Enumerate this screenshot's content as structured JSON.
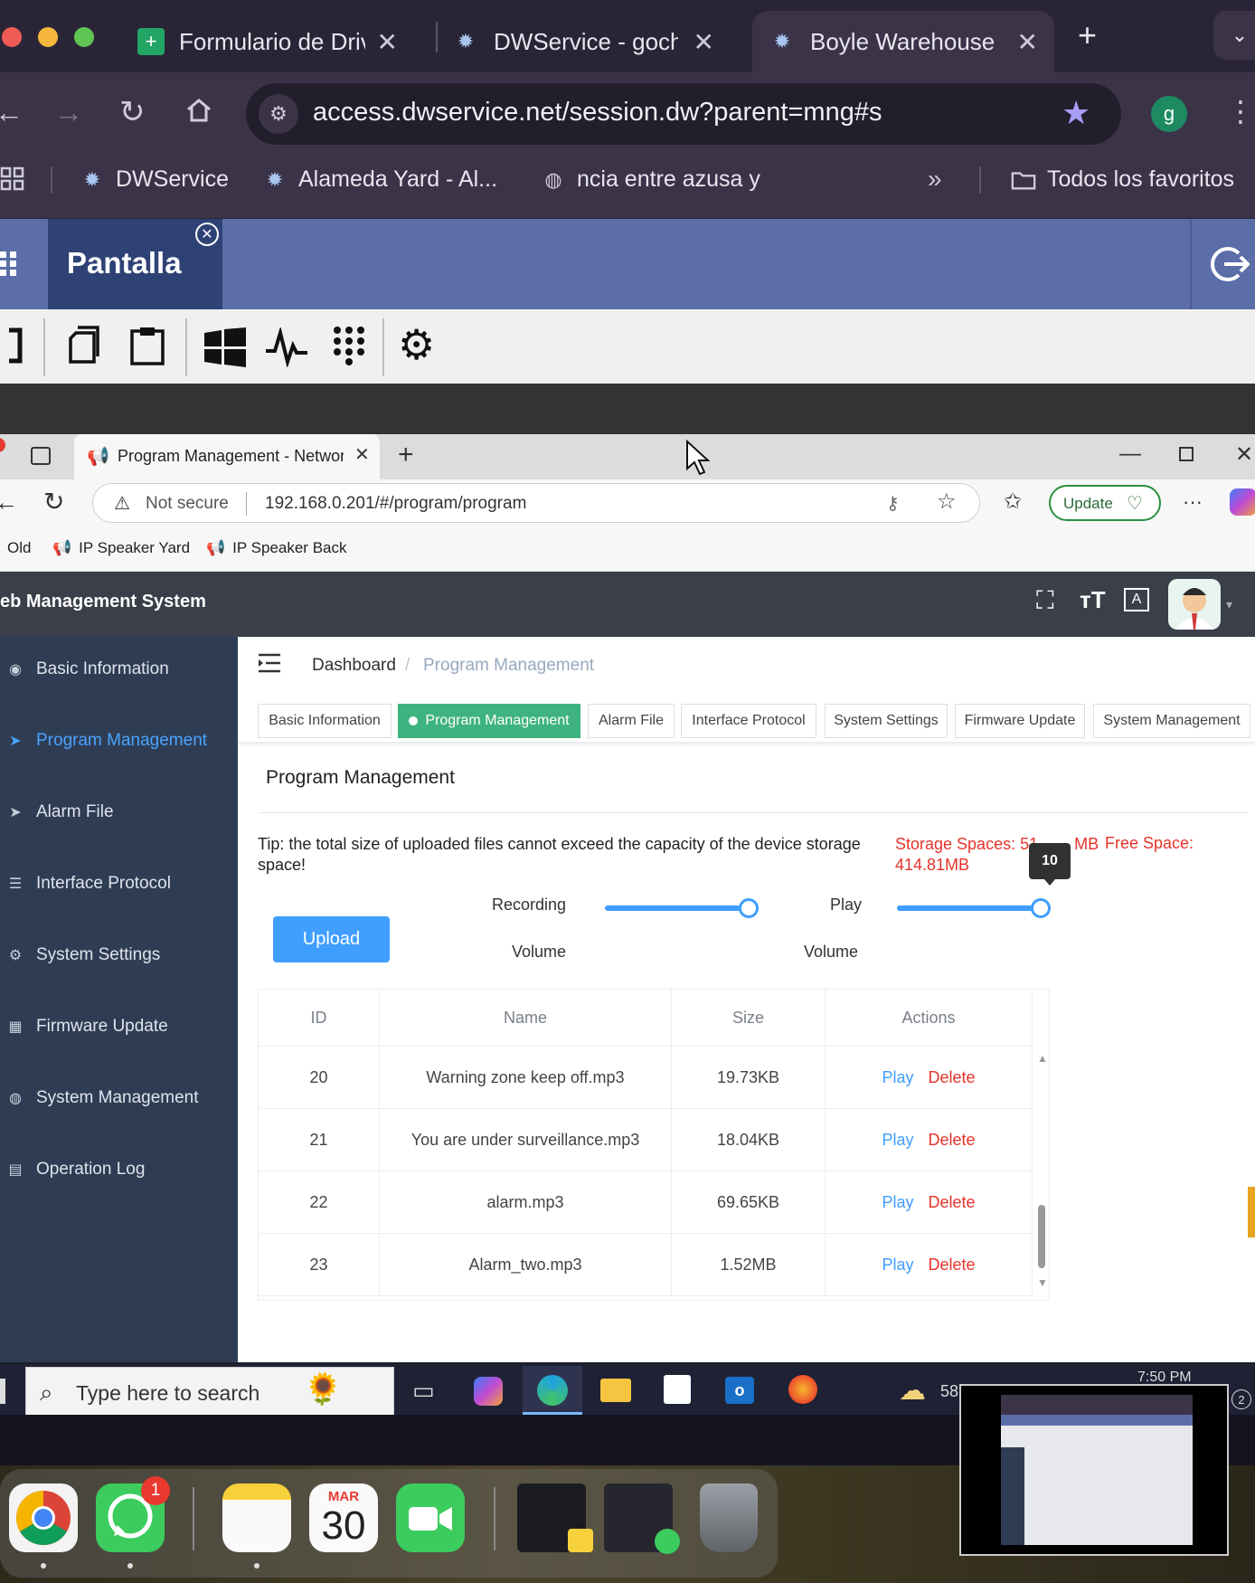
{
  "outer_browser": {
    "tabs": [
      {
        "title": "Formulario de Driv",
        "active": false
      },
      {
        "title": "DWService - goch",
        "active": false
      },
      {
        "title": "Boyle Warehouse",
        "active": true
      }
    ],
    "url": "access.dwservice.net/session.dw?parent=mng#s",
    "profile_initial": "g",
    "bookmarks": [
      {
        "label": "DWService"
      },
      {
        "label": "Alameda Yard - Al..."
      },
      {
        "label": "ncia entre azusa y"
      }
    ],
    "bookmarks_folder": "Todos los favoritos"
  },
  "dwservice": {
    "tab_title": "Pantalla"
  },
  "inner_browser": {
    "tab_title": "Program Management - Network",
    "not_secure": "Not secure",
    "url": "192.168.0.201/#/program/program",
    "update_label": "Update",
    "bookmarks": [
      {
        "label": "Old"
      },
      {
        "label": "IP Speaker Yard"
      },
      {
        "label": "IP Speaker Back"
      }
    ]
  },
  "wms": {
    "title": "eb Management System",
    "sidebar": [
      {
        "label": "Basic Information",
        "active": false
      },
      {
        "label": "Program Management",
        "active": true
      },
      {
        "label": "Alarm File",
        "active": false
      },
      {
        "label": "Interface Protocol",
        "active": false
      },
      {
        "label": "System Settings",
        "active": false
      },
      {
        "label": "Firmware Update",
        "active": false
      },
      {
        "label": "System Management",
        "active": false
      },
      {
        "label": "Operation Log",
        "active": false
      }
    ],
    "breadcrumb": {
      "home": "Dashboard",
      "sep": "/",
      "current": "Program Management"
    },
    "subtabs": [
      {
        "label": "Basic Information",
        "active": false
      },
      {
        "label": "Program Management",
        "active": true
      },
      {
        "label": "Alarm File",
        "active": false
      },
      {
        "label": "Interface Protocol",
        "active": false
      },
      {
        "label": "System Settings",
        "active": false
      },
      {
        "label": "Firmware Update",
        "active": false
      },
      {
        "label": "System Management",
        "active": false
      }
    ],
    "section_title": "Program Management",
    "tip": "Tip: the total size of uploaded files cannot exceed the capacity of the device storage space!",
    "storage_label_a": "Storage Spaces: 51",
    "storage_label_b": "MB",
    "storage_free_value": "414.81MB",
    "free_label": "Free Space:",
    "recording_label": "Recording",
    "recording_label2": "Volume",
    "recording_level": 1.0,
    "play_label": "Play",
    "play_label2": "Volume",
    "play_level": 1.0,
    "play_tooltip": "10",
    "upload_label": "Upload",
    "table": {
      "headers": [
        "ID",
        "Name",
        "Size",
        "Actions"
      ],
      "rows": [
        {
          "id": "20",
          "name": "Warning zone keep off.mp3",
          "size": "19.73KB"
        },
        {
          "id": "21",
          "name": "You are under surveillance.mp3",
          "size": "18.04KB"
        },
        {
          "id": "22",
          "name": "alarm.mp3",
          "size": "69.65KB"
        },
        {
          "id": "23",
          "name": "Alarm_two.mp3",
          "size": "1.52MB"
        }
      ],
      "play_label": "Play",
      "delete_label": "Delete"
    }
  },
  "windows_taskbar": {
    "search_placeholder": "Type here to search",
    "weather_temp": "58",
    "clock": "7:50 PM",
    "notif_count": "2"
  },
  "dock": {
    "calendar_month": "MAR",
    "calendar_day": "30",
    "whatsapp_badge": "1"
  }
}
